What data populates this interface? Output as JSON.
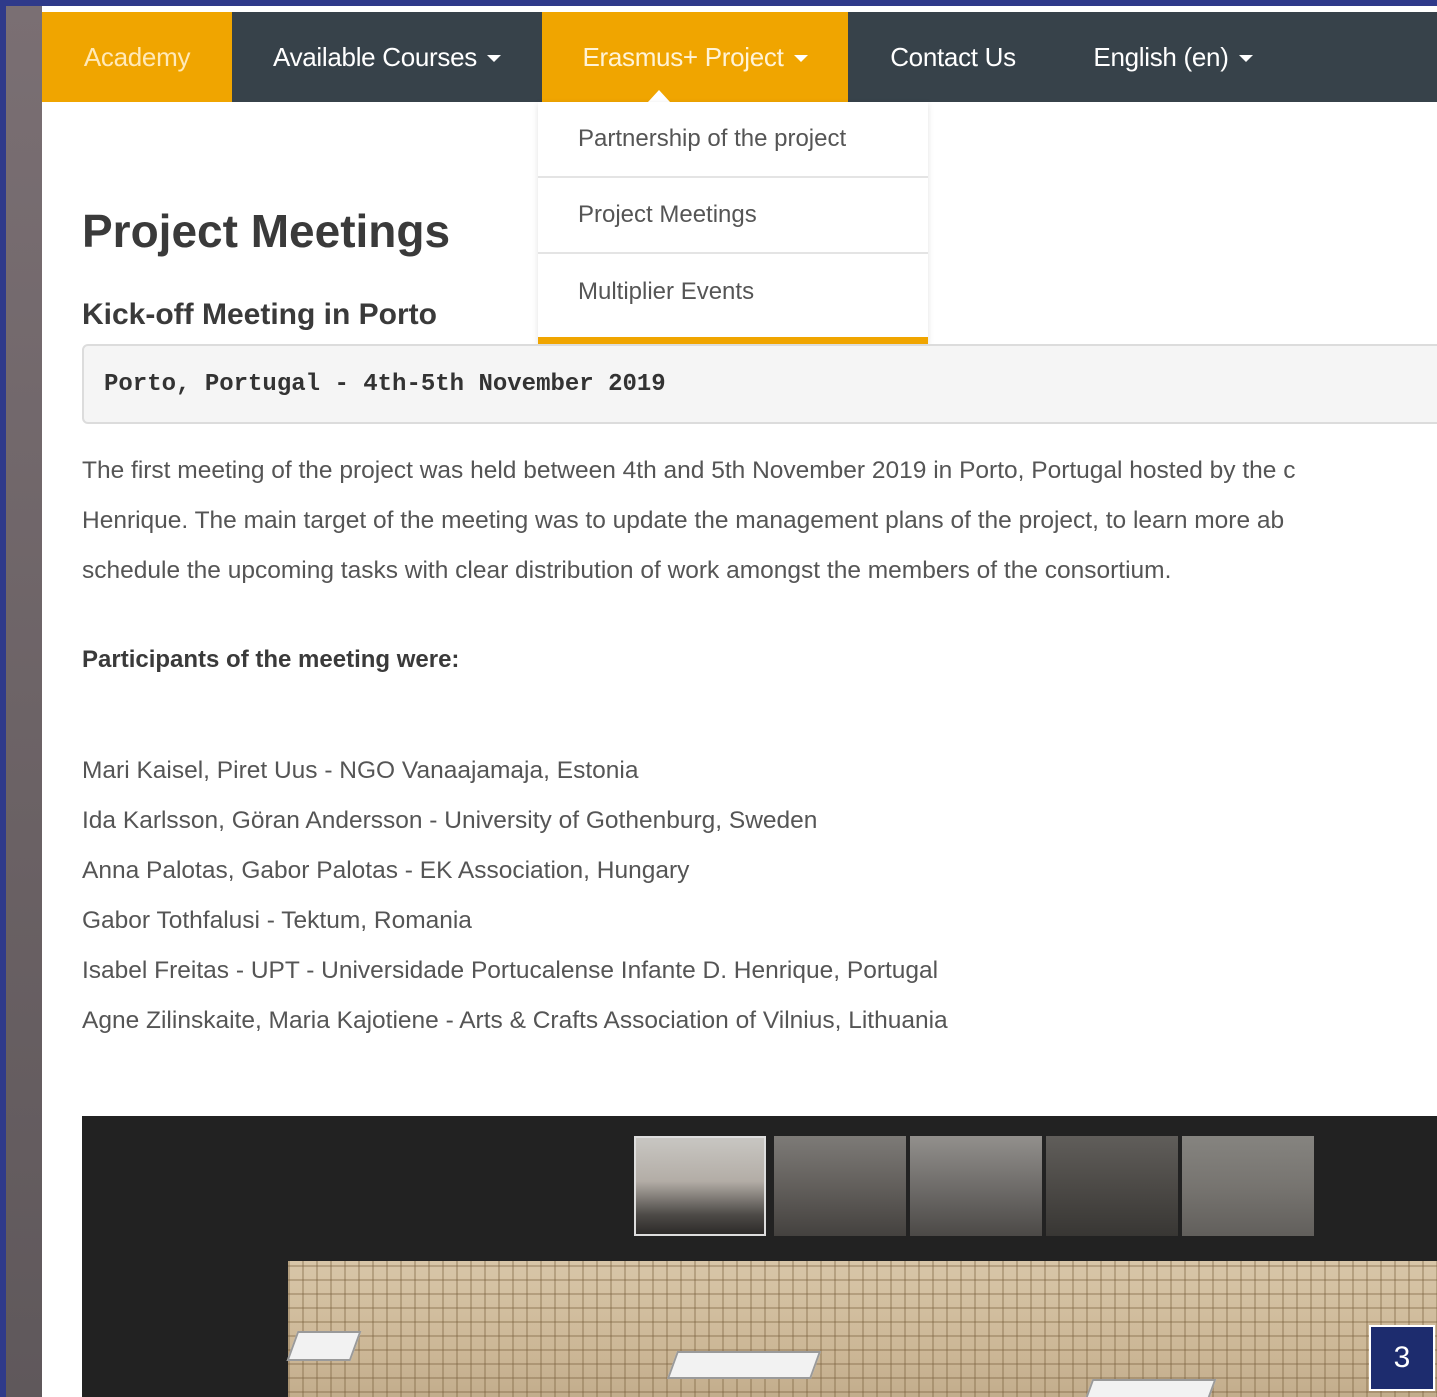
{
  "nav": {
    "academy": "Academy",
    "courses": "Available Courses",
    "erasmus": "Erasmus+ Project",
    "contact": "Contact Us",
    "language": "English (en)"
  },
  "dropdown": {
    "items": [
      "Partnership of the project",
      "Project Meetings",
      "Multiplier Events"
    ]
  },
  "page": {
    "title": "Project Meetings",
    "meeting_title": "Kick-off Meeting in Porto",
    "location_date": "Porto, Portugal - 4th-5th November 2019",
    "paragraph_lines": [
      "The first meeting of the project was held between 4th and 5th November 2019 in Porto, Portugal hosted by the c",
      "Henrique. The main target of the meeting was to update the management plans of the project, to learn more ab",
      "schedule the upcoming tasks with clear distribution of work amongst the members of the consortium."
    ],
    "participants_label": "Participants of the meeting were:",
    "participants": [
      "Mari Kaisel, Piret Uus - NGO Vanaajamaja, Estonia",
      "Ida Karlsson, Göran Andersson - University of Gothenburg, Sweden",
      "Anna Palotas, Gabor Palotas - EK Association, Hungary",
      "Gabor Tothfalusi - Tektum, Romania",
      "Isabel Freitas - UPT - Universidade Portucalense Infante D. Henrique, Portugal",
      "Agne Zilinskaite, Maria Kajotiene - Arts & Crafts Association of Vilnius, Lithuania"
    ]
  },
  "badge": {
    "page_number": "3"
  },
  "colors": {
    "nav_bg": "#37424a",
    "accent": "#f0a500",
    "badge_bg": "#1d2c6e"
  }
}
